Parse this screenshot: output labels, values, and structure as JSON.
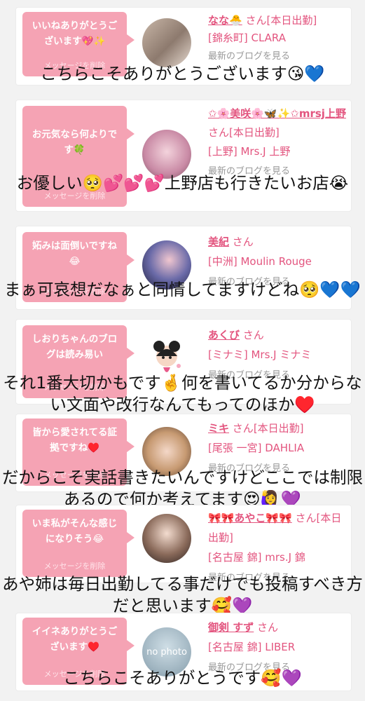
{
  "items": [
    {
      "bubble": "いいねありがとうございます💖✨",
      "delete_label": "メッセージを削除",
      "name": "なな🐣",
      "san": "さん",
      "status": "[本日出勤]",
      "location": "[錦糸町] CLARA",
      "blog_link": "最新のブログを見る",
      "caption": "こちらこそありがとうございます😘💙"
    },
    {
      "bubble": "お元気なら何よりです🍀",
      "delete_label": "メッセージを削除",
      "name": "✩🌸美咲🌸🦋✨✩mrsj上野",
      "san": "さん",
      "status": "[本日出勤]",
      "location": "[上野] Mrs.J 上野",
      "blog_link": "最新のブログを見る",
      "caption": "お優しい🥺💕💕💕上野店も行きたいお店😭"
    },
    {
      "bubble": "妬みは面倒いですね😂",
      "delete_label": "メッセージを削除",
      "name": "美紀",
      "san": "さん",
      "status": "",
      "location": "[中洲] Moulin Rouge",
      "blog_link": "最新のブログを見る",
      "caption": "まぁ可哀想だなぁと同情してますけどね🥺💙💙"
    },
    {
      "bubble": "しおりちゃんのブログは読み易い",
      "delete_label": "メッセージを削除",
      "name": "あくび",
      "san": "さん",
      "status": "",
      "location": "[ミナミ] Mrs.J ミナミ",
      "blog_link": "最新のブログを見る",
      "caption": "それ1番大切かもです🤞何を書いてるか分からない文面や改行なんてもってのほか♥️"
    },
    {
      "bubble": "皆から愛されてる証拠ですね♥️",
      "delete_label": "メッセージを削除",
      "name": "ミキ",
      "san": "さん",
      "status": "[本日出勤]",
      "location": "[尾張 一宮] DAHLIA",
      "blog_link": "最新のブログを見る",
      "caption": "だからこそ実話書きたいんですけどここでは制限あるので何か考えてます😍🙋‍♀️💜"
    },
    {
      "bubble": "いま私がそんな感じになりそう😂",
      "delete_label": "メッセージを削除",
      "name": "🎀🎀あやこ🎀🎀",
      "san": "さん",
      "status": "[本日出勤]",
      "location": "[名古屋 錦] mrs.J 錦",
      "blog_link": "最新のブログを見る",
      "caption": "あや姉は毎日出勤してる事だけでも投稿すべき方だと思います🥰💜"
    },
    {
      "bubble": "イイネありがとうございます♥️",
      "delete_label": "メッセージを削除",
      "name": "御剣 すず",
      "san": "さん",
      "status": "",
      "location": "[名古屋 錦] LIBER",
      "blog_link": "最新のブログを見る",
      "avatar_text": "no photo",
      "caption": "こちらこそありがとうです🥰💜"
    }
  ],
  "colors": {
    "bubble": "#f5a3b4",
    "accent": "#e3557f",
    "background": "#f2f2f2"
  }
}
